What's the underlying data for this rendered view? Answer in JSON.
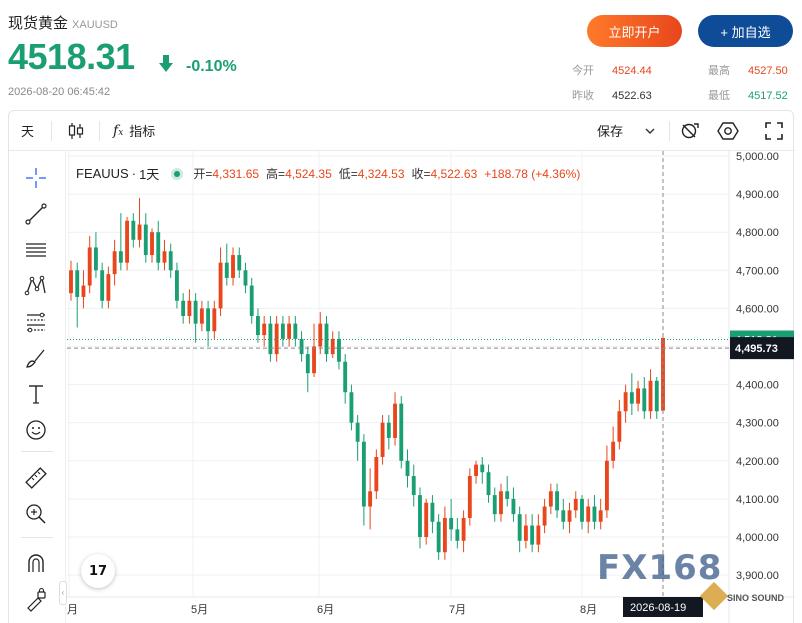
{
  "header": {
    "title": "现货黄金",
    "code": "XAUUSD",
    "price": "4518.31",
    "change_pct": "-0.10%",
    "datetime": "2026-08-20 06:45:42",
    "open_account_label": "立即开户",
    "add_watch_label": "+ 加自选",
    "stats": {
      "open_label": "今开",
      "open_value": "4524.44",
      "high_label": "最高",
      "high_value": "4527.50",
      "prev_close_label": "昨收",
      "prev_close_value": "4522.63",
      "low_label": "最低",
      "low_value": "4517.52"
    }
  },
  "toolbar": {
    "interval_label": "天",
    "indicators_label": "指标",
    "save_label": "保存"
  },
  "legend": {
    "symbol": "FEAUUS",
    "sep": "·",
    "interval": "1天",
    "open_key": "开=",
    "open_value": "4,331.65",
    "high_key": "高=",
    "high_value": "4,524.35",
    "low_key": "低=",
    "low_value": "4,324.53",
    "close_key": "收=",
    "close_value": "4,522.63",
    "change": "+188.78 (+4.36%)"
  },
  "watermark": {
    "text": "FX168",
    "brand": "SINO SOUND"
  },
  "chart_data": {
    "type": "candlestick",
    "y_axis_ticks": [
      "5,000.00",
      "4,900.00",
      "4,800.00",
      "4,700.00",
      "4,600.00",
      "4,500.00",
      "4,400.00",
      "4,300.00",
      "4,200.00",
      "4,100.00",
      "4,000.00",
      "3,900.00"
    ],
    "x_axis_ticks": [
      "月",
      "5月",
      "6月",
      "7月",
      "8月"
    ],
    "ylim": [
      3870,
      5010
    ],
    "last_price_label": "4,518.31",
    "crosshair_price_label": "4,495.73",
    "crosshair_date_label": "2026-08-19",
    "up_color": "#e8461c",
    "down_color": "#1a9e73",
    "candles": [
      [
        4640,
        4700,
        4620,
        4725
      ],
      [
        4700,
        4630,
        4550,
        4720
      ],
      [
        4630,
        4660,
        4600,
        4700
      ],
      [
        4660,
        4760,
        4640,
        4790
      ],
      [
        4760,
        4700,
        4680,
        4800
      ],
      [
        4700,
        4620,
        4600,
        4720
      ],
      [
        4620,
        4690,
        4600,
        4710
      ],
      [
        4690,
        4750,
        4660,
        4780
      ],
      [
        4750,
        4720,
        4700,
        4850
      ],
      [
        4720,
        4830,
        4700,
        4840
      ],
      [
        4830,
        4780,
        4760,
        4850
      ],
      [
        4780,
        4820,
        4760,
        4890
      ],
      [
        4820,
        4740,
        4720,
        4850
      ],
      [
        4740,
        4800,
        4720,
        4810
      ],
      [
        4800,
        4720,
        4700,
        4830
      ],
      [
        4720,
        4750,
        4700,
        4780
      ],
      [
        4750,
        4700,
        4680,
        4770
      ],
      [
        4700,
        4620,
        4600,
        4720
      ],
      [
        4620,
        4580,
        4560,
        4640
      ],
      [
        4580,
        4620,
        4560,
        4650
      ],
      [
        4620,
        4560,
        4510,
        4640
      ],
      [
        4560,
        4600,
        4540,
        4620
      ],
      [
        4600,
        4540,
        4500,
        4620
      ],
      [
        4540,
        4600,
        4520,
        4620
      ],
      [
        4600,
        4720,
        4580,
        4760
      ],
      [
        4720,
        4680,
        4660,
        4770
      ],
      [
        4680,
        4740,
        4660,
        4760
      ],
      [
        4740,
        4700,
        4680,
        4760
      ],
      [
        4700,
        4660,
        4640,
        4720
      ],
      [
        4660,
        4580,
        4560,
        4680
      ],
      [
        4580,
        4530,
        4510,
        4600
      ],
      [
        4530,
        4560,
        4500,
        4580
      ],
      [
        4560,
        4480,
        4460,
        4580
      ],
      [
        4480,
        4560,
        4460,
        4580
      ],
      [
        4560,
        4520,
        4500,
        4580
      ],
      [
        4520,
        4560,
        4500,
        4580
      ],
      [
        4560,
        4520,
        4500,
        4580
      ],
      [
        4520,
        4480,
        4460,
        4540
      ],
      [
        4480,
        4430,
        4380,
        4500
      ],
      [
        4430,
        4500,
        4420,
        4560
      ],
      [
        4500,
        4560,
        4480,
        4590
      ],
      [
        4560,
        4480,
        4460,
        4580
      ],
      [
        4480,
        4520,
        4470,
        4540
      ],
      [
        4520,
        4460,
        4440,
        4540
      ],
      [
        4460,
        4380,
        4350,
        4480
      ],
      [
        4380,
        4300,
        4280,
        4400
      ],
      [
        4300,
        4250,
        4200,
        4320
      ],
      [
        4250,
        4080,
        4030,
        4270
      ],
      [
        4080,
        4120,
        4020,
        4180
      ],
      [
        4120,
        4210,
        4100,
        4230
      ],
      [
        4210,
        4300,
        4190,
        4320
      ],
      [
        4300,
        4260,
        4230,
        4320
      ],
      [
        4260,
        4350,
        4240,
        4380
      ],
      [
        4350,
        4200,
        4180,
        4370
      ],
      [
        4200,
        4160,
        4130,
        4230
      ],
      [
        4160,
        4110,
        4080,
        4190
      ],
      [
        4110,
        4000,
        3970,
        4130
      ],
      [
        4000,
        4090,
        3980,
        4100
      ],
      [
        4090,
        4040,
        4010,
        4110
      ],
      [
        4040,
        3960,
        3940,
        4060
      ],
      [
        3960,
        4050,
        3940,
        4080
      ],
      [
        4050,
        4020,
        3990,
        4100
      ],
      [
        4020,
        3990,
        3970,
        4050
      ],
      [
        3990,
        4050,
        3960,
        4070
      ],
      [
        4050,
        4160,
        4030,
        4180
      ],
      [
        4160,
        4190,
        4140,
        4200
      ],
      [
        4190,
        4170,
        4140,
        4210
      ],
      [
        4170,
        4110,
        4090,
        4190
      ],
      [
        4110,
        4060,
        4040,
        4130
      ],
      [
        4060,
        4120,
        4040,
        4140
      ],
      [
        4120,
        4100,
        4080,
        4160
      ],
      [
        4100,
        4060,
        4040,
        4130
      ],
      [
        4060,
        3990,
        3960,
        4080
      ],
      [
        3990,
        4030,
        3970,
        4060
      ],
      [
        4030,
        3980,
        3960,
        4060
      ],
      [
        3980,
        4030,
        3960,
        4060
      ],
      [
        4030,
        4080,
        4010,
        4100
      ],
      [
        4080,
        4120,
        4060,
        4140
      ],
      [
        4120,
        4070,
        4050,
        4140
      ],
      [
        4070,
        4040,
        4020,
        4100
      ],
      [
        4040,
        4070,
        4010,
        4090
      ],
      [
        4070,
        4100,
        4050,
        4120
      ],
      [
        4100,
        4040,
        4020,
        4110
      ],
      [
        4040,
        4080,
        4010,
        4100
      ],
      [
        4080,
        4040,
        4020,
        4110
      ],
      [
        4040,
        4070,
        4020,
        4100
      ],
      [
        4070,
        4200,
        4050,
        4240
      ],
      [
        4200,
        4250,
        4180,
        4290
      ],
      [
        4250,
        4330,
        4230,
        4360
      ],
      [
        4330,
        4380,
        4300,
        4400
      ],
      [
        4380,
        4350,
        4320,
        4430
      ],
      [
        4350,
        4390,
        4330,
        4410
      ],
      [
        4390,
        4330,
        4310,
        4420
      ],
      [
        4330,
        4410,
        4310,
        4440
      ],
      [
        4410,
        4330,
        4310,
        4420
      ],
      [
        4331.65,
        4522.63,
        4324.53,
        4524.35
      ]
    ]
  }
}
